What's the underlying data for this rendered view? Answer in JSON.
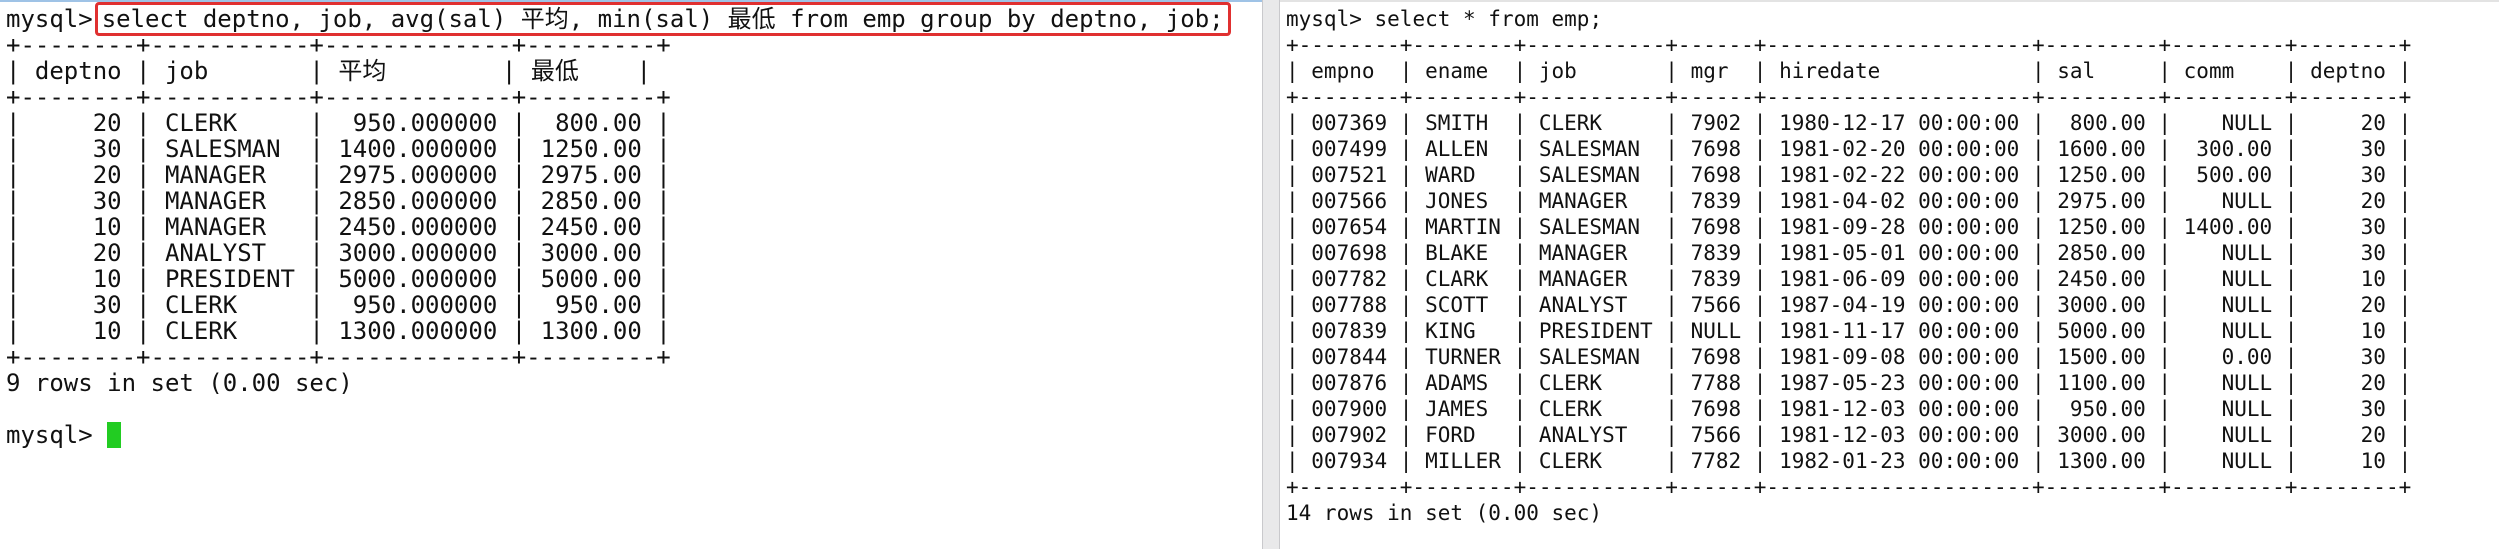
{
  "left": {
    "prompt": "mysql>",
    "query": "select deptno, job, avg(sal) 平均, min(sal) 最低 from emp group by deptno, job;",
    "columns": [
      "deptno",
      "job",
      "平均",
      "最低"
    ],
    "rows": [
      [
        "20",
        "CLERK",
        "950.000000",
        "800.00"
      ],
      [
        "30",
        "SALESMAN",
        "1400.000000",
        "1250.00"
      ],
      [
        "20",
        "MANAGER",
        "2975.000000",
        "2975.00"
      ],
      [
        "30",
        "MANAGER",
        "2850.000000",
        "2850.00"
      ],
      [
        "10",
        "MANAGER",
        "2450.000000",
        "2450.00"
      ],
      [
        "20",
        "ANALYST",
        "3000.000000",
        "3000.00"
      ],
      [
        "10",
        "PRESIDENT",
        "5000.000000",
        "5000.00"
      ],
      [
        "30",
        "CLERK",
        "950.000000",
        "950.00"
      ],
      [
        "10",
        "CLERK",
        "1300.000000",
        "1300.00"
      ]
    ],
    "footer": "9 rows in set (0.00 sec)",
    "prompt2": "mysql>"
  },
  "right": {
    "prompt": "mysql>",
    "query": "select * from emp;",
    "columns": [
      "empno",
      "ename",
      "job",
      "mgr",
      "hiredate",
      "sal",
      "comm",
      "deptno"
    ],
    "rows": [
      [
        "007369",
        "SMITH",
        "CLERK",
        "7902",
        "1980-12-17 00:00:00",
        "800.00",
        "NULL",
        "20"
      ],
      [
        "007499",
        "ALLEN",
        "SALESMAN",
        "7698",
        "1981-02-20 00:00:00",
        "1600.00",
        "300.00",
        "30"
      ],
      [
        "007521",
        "WARD",
        "SALESMAN",
        "7698",
        "1981-02-22 00:00:00",
        "1250.00",
        "500.00",
        "30"
      ],
      [
        "007566",
        "JONES",
        "MANAGER",
        "7839",
        "1981-04-02 00:00:00",
        "2975.00",
        "NULL",
        "20"
      ],
      [
        "007654",
        "MARTIN",
        "SALESMAN",
        "7698",
        "1981-09-28 00:00:00",
        "1250.00",
        "1400.00",
        "30"
      ],
      [
        "007698",
        "BLAKE",
        "MANAGER",
        "7839",
        "1981-05-01 00:00:00",
        "2850.00",
        "NULL",
        "30"
      ],
      [
        "007782",
        "CLARK",
        "MANAGER",
        "7839",
        "1981-06-09 00:00:00",
        "2450.00",
        "NULL",
        "10"
      ],
      [
        "007788",
        "SCOTT",
        "ANALYST",
        "7566",
        "1987-04-19 00:00:00",
        "3000.00",
        "NULL",
        "20"
      ],
      [
        "007839",
        "KING",
        "PRESIDENT",
        "NULL",
        "1981-11-17 00:00:00",
        "5000.00",
        "NULL",
        "10"
      ],
      [
        "007844",
        "TURNER",
        "SALESMAN",
        "7698",
        "1981-09-08 00:00:00",
        "1500.00",
        "0.00",
        "30"
      ],
      [
        "007876",
        "ADAMS",
        "CLERK",
        "7788",
        "1987-05-23 00:00:00",
        "1100.00",
        "NULL",
        "20"
      ],
      [
        "007900",
        "JAMES",
        "CLERK",
        "7698",
        "1981-12-03 00:00:00",
        "950.00",
        "NULL",
        "30"
      ],
      [
        "007902",
        "FORD",
        "ANALYST",
        "7566",
        "1981-12-03 00:00:00",
        "3000.00",
        "NULL",
        "20"
      ],
      [
        "007934",
        "MILLER",
        "CLERK",
        "7782",
        "1982-01-23 00:00:00",
        "1300.00",
        "NULL",
        "10"
      ]
    ],
    "footer": "14 rows in set (0.00 sec)"
  },
  "colors": {
    "highlight_border": "#e03030",
    "cursor": "#22cc22",
    "text": "#111111"
  }
}
